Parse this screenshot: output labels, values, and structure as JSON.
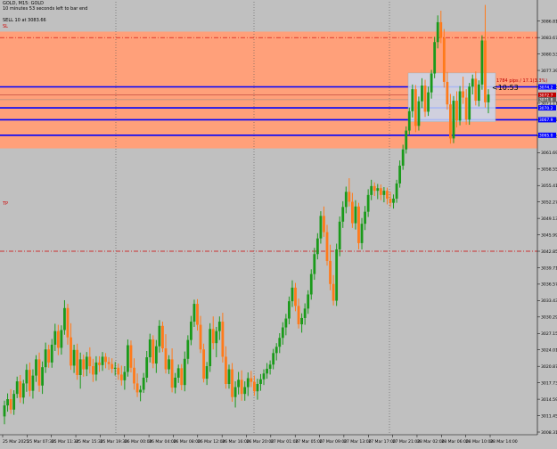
{
  "header": {
    "line1": "GOLD, M15: GOLD",
    "line2": "10 minutes 53 seconds left to bar end",
    "sell_label": "SELL 10 at 3083.66"
  },
  "overlay": {
    "countdown": "<10:53",
    "pips_text": "1784 pips / 17.1(3.3%)"
  },
  "colors": {
    "background": "#c0c0c0",
    "zone": "#ffa07a",
    "bull": "#1a9a1a",
    "bear": "#ff7a1a",
    "sell_line": "#d00000",
    "level": "#0000ff",
    "box": "#c8d8f0"
  },
  "chart_data": {
    "type": "candlestick",
    "title": "GOLD, M15: GOLD",
    "ylim": [
      3007.8,
      3090.5
    ],
    "y_ticks": [
      "3086.81",
      "3083.67",
      "3080.53",
      "3077.39",
      "3074.25",
      "3071.11",
      "3067.97",
      "3064.83",
      "3061.69",
      "3058.55",
      "3055.41",
      "3052.27",
      "3049.13",
      "3045.99",
      "3042.85",
      "3039.71",
      "3036.57",
      "3033.43",
      "3030.29",
      "3027.15",
      "3024.01",
      "3020.87",
      "3017.73",
      "3014.59",
      "3011.45",
      "3008.31"
    ],
    "x_ticks": [
      "25 Mar 2025",
      "25 Mar 07:30",
      "25 Mar 11:30",
      "25 Mar 15:30",
      "25 Mar 19:30",
      "26 Mar 00:00",
      "26 Mar 04:00",
      "26 Mar 08:00",
      "26 Mar 12:00",
      "26 Mar 16:00",
      "26 Mar 20:00",
      "27 Mar 01:00",
      "27 Mar 05:00",
      "27 Mar 09:00",
      "27 Mar 13:00",
      "27 Mar 17:00",
      "27 Mar 21:00",
      "28 Mar 02:00",
      "28 Mar 06:00",
      "28 Mar 10:00",
      "28 Mar 14:00"
    ],
    "sell_level": 3083.66,
    "zone": [
      3062.5,
      3084.8
    ],
    "blue_levels": [
      3074.25,
      3070.24,
      3067.97,
      3065.0
    ],
    "blue_level_labels": [
      "3074.2",
      "3070.2",
      "3067.9",
      "3065.0"
    ],
    "right_tags": [
      "3072.7",
      "3071.8"
    ],
    "lower_dashed_level": 3042.85,
    "lower_dashed_label": "TP",
    "candles": [
      [
        3011.3,
        3014.3,
        3009.8,
        3013.4
      ],
      [
        3013.4,
        3015.7,
        3012.2,
        3014.6
      ],
      [
        3014.6,
        3016.5,
        3011.8,
        3012.6
      ],
      [
        3012.6,
        3016.3,
        3011.6,
        3015.6
      ],
      [
        3015.6,
        3018.9,
        3014.8,
        3018.0
      ],
      [
        3018.0,
        3019.2,
        3013.9,
        3014.9
      ],
      [
        3014.9,
        3018.3,
        3013.7,
        3017.6
      ],
      [
        3017.6,
        3021.3,
        3016.0,
        3020.2
      ],
      [
        3020.2,
        3021.6,
        3015.1,
        3016.2
      ],
      [
        3016.2,
        3020.3,
        3014.7,
        3019.1
      ],
      [
        3019.1,
        3023.0,
        3017.9,
        3022.2
      ],
      [
        3022.2,
        3023.5,
        3016.0,
        3017.2
      ],
      [
        3017.2,
        3021.8,
        3015.6,
        3020.7
      ],
      [
        3020.7,
        3025.4,
        3019.6,
        3024.1
      ],
      [
        3024.1,
        3025.0,
        3020.6,
        3021.6
      ],
      [
        3021.6,
        3026.1,
        3020.6,
        3025.0
      ],
      [
        3025.0,
        3029.0,
        3023.8,
        3027.6
      ],
      [
        3027.6,
        3028.8,
        3023.0,
        3024.4
      ],
      [
        3024.4,
        3028.7,
        3023.1,
        3027.8
      ],
      [
        3027.8,
        3033.5,
        3026.9,
        3032.0
      ],
      [
        3032.0,
        3032.8,
        3025.0,
        3026.4
      ],
      [
        3026.4,
        3029.1,
        3020.2,
        3021.0
      ],
      [
        3021.0,
        3025.0,
        3019.6,
        3024.0
      ],
      [
        3024.0,
        3025.2,
        3018.3,
        3019.2
      ],
      [
        3019.2,
        3023.5,
        3016.6,
        3022.2
      ],
      [
        3022.2,
        3023.1,
        3018.9,
        3020.3
      ],
      [
        3020.3,
        3023.6,
        3019.0,
        3022.7
      ],
      [
        3022.7,
        3024.5,
        3019.5,
        3020.9
      ],
      [
        3020.9,
        3022.3,
        3017.9,
        3019.3
      ],
      [
        3019.3,
        3022.8,
        3018.1,
        3021.6
      ],
      [
        3021.6,
        3022.8,
        3019.8,
        3021.1
      ],
      [
        3021.1,
        3023.6,
        3020.0,
        3022.7
      ],
      [
        3022.7,
        3023.4,
        3020.5,
        3021.7
      ],
      [
        3021.7,
        3022.6,
        3020.2,
        3021.3
      ],
      [
        3021.3,
        3022.4,
        3019.6,
        3020.4
      ],
      [
        3020.4,
        3021.7,
        3019.1,
        3020.6
      ],
      [
        3020.6,
        3021.4,
        3018.3,
        3019.3
      ],
      [
        3019.3,
        3021.0,
        3017.2,
        3018.2
      ],
      [
        3018.2,
        3020.9,
        3016.4,
        3019.8
      ],
      [
        3019.8,
        3026.0,
        3018.9,
        3024.9
      ],
      [
        3024.9,
        3025.8,
        3019.7,
        3020.6
      ],
      [
        3020.6,
        3022.4,
        3016.4,
        3017.6
      ],
      [
        3017.6,
        3019.5,
        3015.0,
        3015.9
      ],
      [
        3015.9,
        3017.2,
        3014.2,
        3016.4
      ],
      [
        3016.4,
        3019.6,
        3015.8,
        3018.7
      ],
      [
        3018.7,
        3023.8,
        3017.8,
        3022.6
      ],
      [
        3022.6,
        3027.1,
        3021.6,
        3026.0
      ],
      [
        3026.0,
        3026.8,
        3020.5,
        3021.4
      ],
      [
        3021.4,
        3025.9,
        3019.6,
        3024.7
      ],
      [
        3024.7,
        3029.7,
        3023.5,
        3028.6
      ],
      [
        3028.6,
        3029.4,
        3023.6,
        3024.3
      ],
      [
        3024.3,
        3027.0,
        3019.5,
        3020.3
      ],
      [
        3020.3,
        3023.0,
        3019.4,
        3022.2
      ],
      [
        3022.2,
        3024.3,
        3015.9,
        3016.8
      ],
      [
        3016.8,
        3019.6,
        3015.7,
        3018.7
      ],
      [
        3018.7,
        3021.2,
        3017.7,
        3020.5
      ],
      [
        3020.5,
        3021.3,
        3016.3,
        3017.3
      ],
      [
        3017.3,
        3023.7,
        3016.1,
        3022.3
      ],
      [
        3022.3,
        3026.8,
        3021.3,
        3025.9
      ],
      [
        3025.9,
        3030.5,
        3024.9,
        3029.4
      ],
      [
        3029.4,
        3033.6,
        3028.4,
        3032.8
      ],
      [
        3032.8,
        3033.7,
        3027.7,
        3028.8
      ],
      [
        3028.8,
        3030.5,
        3023.4,
        3024.1
      ],
      [
        3024.1,
        3025.2,
        3017.8,
        3018.5
      ],
      [
        3018.5,
        3021.7,
        3017.3,
        3020.9
      ],
      [
        3020.9,
        3029.1,
        3019.8,
        3028.0
      ],
      [
        3028.0,
        3030.4,
        3024.1,
        3025.3
      ],
      [
        3025.3,
        3028.4,
        3022.6,
        3027.6
      ],
      [
        3027.6,
        3030.4,
        3025.9,
        3029.4
      ],
      [
        3029.4,
        3031.1,
        3021.6,
        3022.7
      ],
      [
        3022.7,
        3024.7,
        3016.6,
        3017.5
      ],
      [
        3017.5,
        3021.2,
        3016.6,
        3020.3
      ],
      [
        3020.3,
        3021.5,
        3014.1,
        3015.0
      ],
      [
        3015.0,
        3018.0,
        3013.0,
        3016.9
      ],
      [
        3016.9,
        3019.8,
        3015.5,
        3018.3
      ],
      [
        3018.3,
        3020.1,
        3014.3,
        3015.6
      ],
      [
        3015.6,
        3018.0,
        3014.3,
        3016.9
      ],
      [
        3016.9,
        3019.7,
        3015.2,
        3018.6
      ],
      [
        3018.6,
        3020.0,
        3016.9,
        3017.9
      ],
      [
        3017.9,
        3019.1,
        3015.2,
        3016.1
      ],
      [
        3016.1,
        3018.5,
        3014.5,
        3017.5
      ],
      [
        3017.5,
        3019.4,
        3016.2,
        3018.4
      ],
      [
        3018.4,
        3020.3,
        3017.3,
        3019.5
      ],
      [
        3019.5,
        3021.5,
        3018.5,
        3020.4
      ],
      [
        3020.4,
        3022.0,
        3019.3,
        3021.2
      ],
      [
        3021.2,
        3024.2,
        3020.3,
        3023.4
      ],
      [
        3023.4,
        3025.3,
        3022.0,
        3024.6
      ],
      [
        3024.6,
        3027.2,
        3023.4,
        3026.3
      ],
      [
        3026.3,
        3029.3,
        3025.0,
        3028.3
      ],
      [
        3028.3,
        3030.9,
        3026.8,
        3030.0
      ],
      [
        3030.0,
        3034.2,
        3028.9,
        3033.3
      ],
      [
        3033.3,
        3037.3,
        3032.2,
        3035.9
      ],
      [
        3035.9,
        3036.8,
        3031.4,
        3032.4
      ],
      [
        3032.4,
        3033.8,
        3028.1,
        3028.9
      ],
      [
        3028.9,
        3031.0,
        3027.3,
        3030.1
      ],
      [
        3030.1,
        3032.9,
        3028.8,
        3031.9
      ],
      [
        3031.9,
        3035.4,
        3030.9,
        3034.6
      ],
      [
        3034.6,
        3039.4,
        3033.6,
        3038.5
      ],
      [
        3038.5,
        3043.5,
        3037.4,
        3042.3
      ],
      [
        3042.3,
        3046.3,
        3041.3,
        3045.3
      ],
      [
        3045.3,
        3050.5,
        3044.3,
        3049.6
      ],
      [
        3049.6,
        3051.4,
        3045.6,
        3046.5
      ],
      [
        3046.5,
        3047.9,
        3040.1,
        3041.0
      ],
      [
        3041.0,
        3044.1,
        3035.4,
        3036.6
      ],
      [
        3036.6,
        3038.3,
        3032.5,
        3033.4
      ],
      [
        3033.4,
        3044.3,
        3032.4,
        3043.2
      ],
      [
        3043.2,
        3049.5,
        3041.9,
        3048.5
      ],
      [
        3048.5,
        3052.4,
        3047.3,
        3051.3
      ],
      [
        3051.3,
        3055.2,
        3050.1,
        3054.2
      ],
      [
        3054.2,
        3056.8,
        3051.4,
        3052.3
      ],
      [
        3052.3,
        3054.0,
        3047.3,
        3048.2
      ],
      [
        3048.2,
        3052.6,
        3047.0,
        3051.4
      ],
      [
        3051.4,
        3052.1,
        3043.2,
        3044.4
      ],
      [
        3044.4,
        3049.2,
        3043.2,
        3048.1
      ],
      [
        3048.1,
        3051.5,
        3046.9,
        3050.4
      ],
      [
        3050.4,
        3054.7,
        3049.4,
        3053.6
      ],
      [
        3053.6,
        3056.5,
        3052.6,
        3055.3
      ],
      [
        3055.3,
        3056.0,
        3053.4,
        3054.4
      ],
      [
        3054.4,
        3055.7,
        3052.8,
        3054.9
      ],
      [
        3054.9,
        3055.6,
        3052.6,
        3053.6
      ],
      [
        3053.6,
        3055.1,
        3052.2,
        3054.4
      ],
      [
        3054.4,
        3055.0,
        3051.8,
        3052.9
      ],
      [
        3052.9,
        3054.2,
        3051.3,
        3052.1
      ],
      [
        3052.1,
        3053.7,
        3051.0,
        3052.9
      ],
      [
        3052.9,
        3056.5,
        3052.1,
        3055.8
      ],
      [
        3055.8,
        3060.2,
        3055.0,
        3059.2
      ],
      [
        3059.2,
        3063.2,
        3058.4,
        3062.3
      ],
      [
        3062.3,
        3066.7,
        3061.5,
        3065.9
      ],
      [
        3065.9,
        3070.3,
        3065.1,
        3069.6
      ],
      [
        3069.6,
        3074.7,
        3068.4,
        3073.8
      ],
      [
        3073.8,
        3074.6,
        3065.6,
        3066.8
      ],
      [
        3066.8,
        3072.4,
        3065.9,
        3071.5
      ],
      [
        3071.5,
        3075.9,
        3070.2,
        3074.5
      ],
      [
        3074.5,
        3075.6,
        3068.5,
        3069.5
      ],
      [
        3069.5,
        3074.3,
        3068.7,
        3073.2
      ],
      [
        3073.2,
        3077.5,
        3072.0,
        3076.8
      ],
      [
        3076.8,
        3083.8,
        3075.9,
        3082.8
      ],
      [
        3082.8,
        3087.9,
        3081.6,
        3086.6
      ],
      [
        3086.6,
        3088.8,
        3082.6,
        3083.6
      ],
      [
        3083.6,
        3085.3,
        3074.1,
        3075.2
      ],
      [
        3075.2,
        3077.1,
        3069.9,
        3070.9
      ],
      [
        3070.9,
        3072.9,
        3063.4,
        3064.4
      ],
      [
        3064.4,
        3072.5,
        3063.5,
        3071.6
      ],
      [
        3071.6,
        3073.4,
        3066.5,
        3067.8
      ],
      [
        3067.8,
        3074.4,
        3066.9,
        3073.4
      ],
      [
        3073.4,
        3076.2,
        3071.0,
        3072.2
      ],
      [
        3072.2,
        3073.8,
        3067.0,
        3068.0
      ],
      [
        3068.0,
        3075.0,
        3067.0,
        3074.3
      ],
      [
        3074.3,
        3076.6,
        3072.8,
        3075.8
      ],
      [
        3075.8,
        3077.2,
        3070.7,
        3071.6
      ],
      [
        3071.6,
        3075.5,
        3070.5,
        3074.7
      ],
      [
        3074.7,
        3084.1,
        3073.7,
        3083.1
      ],
      [
        3083.1,
        3089.9,
        3070.3,
        3071.3
      ],
      [
        3071.3,
        3073.8,
        3069.2,
        3072.8
      ]
    ]
  }
}
